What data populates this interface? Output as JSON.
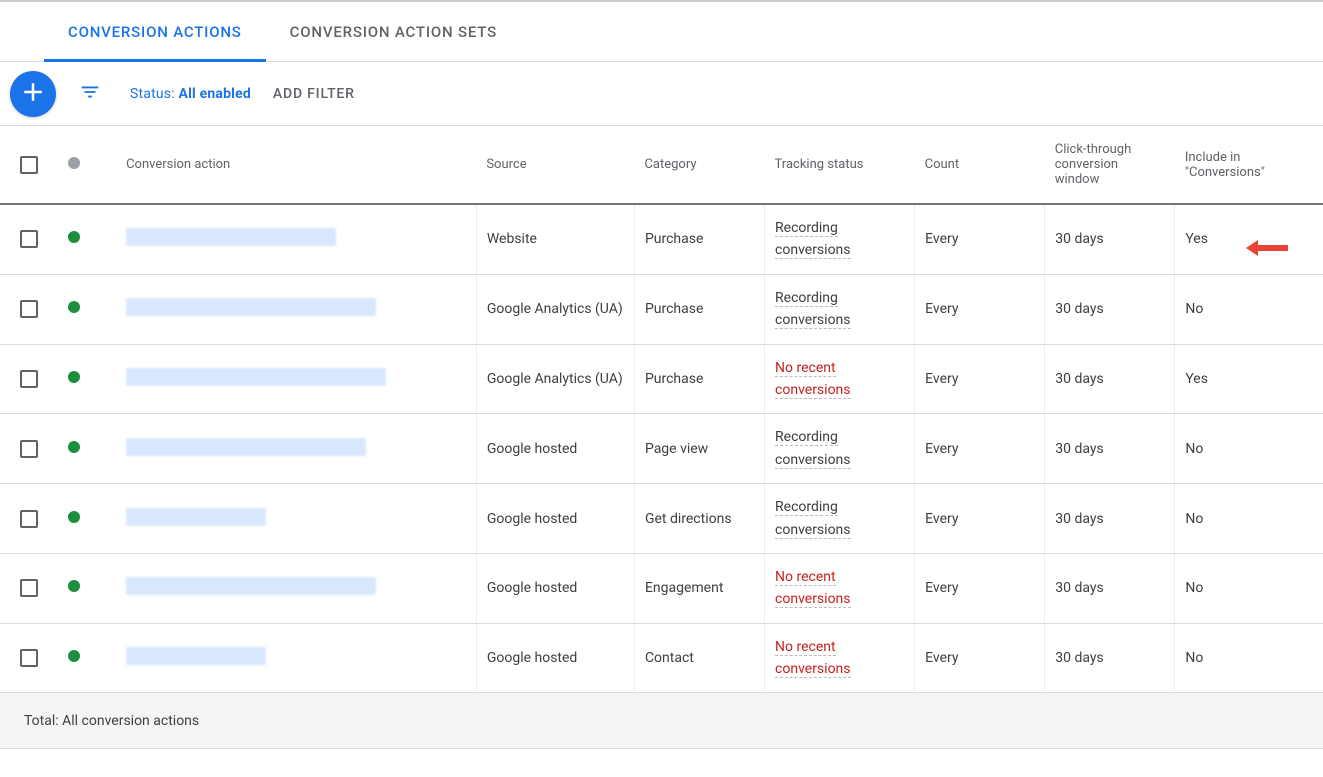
{
  "tabs": {
    "conversion_actions": "CONVERSION ACTIONS",
    "conversion_action_sets": "CONVERSION ACTION SETS"
  },
  "toolbar": {
    "status_label": "Status: ",
    "status_value": "All enabled",
    "add_filter": "ADD FILTER"
  },
  "columns": {
    "conversion_action": "Conversion action",
    "source": "Source",
    "category": "Category",
    "tracking_status": "Tracking status",
    "count": "Count",
    "click_through": "Click-through conversion window",
    "include": "Include in \"Conversions\""
  },
  "rows": [
    {
      "name_w": 210,
      "source": "Website",
      "category": "Purchase",
      "tracking": "Recording conversions",
      "tracking_warn": false,
      "count": "Every",
      "window": "30 days",
      "include": "Yes"
    },
    {
      "name_w": 250,
      "source": "Google Analytics (UA)",
      "category": "Purchase",
      "tracking": "Recording conversions",
      "tracking_warn": false,
      "count": "Every",
      "window": "30 days",
      "include": "No"
    },
    {
      "name_w": 260,
      "source": "Google Analytics (UA)",
      "category": "Purchase",
      "tracking": "No recent conversions",
      "tracking_warn": true,
      "count": "Every",
      "window": "30 days",
      "include": "Yes"
    },
    {
      "name_w": 240,
      "source": "Google hosted",
      "category": "Page view",
      "tracking": "Recording conversions",
      "tracking_warn": false,
      "count": "Every",
      "window": "30 days",
      "include": "No"
    },
    {
      "name_w": 140,
      "source": "Google hosted",
      "category": "Get directions",
      "tracking": "Recording conversions",
      "tracking_warn": false,
      "count": "Every",
      "window": "30 days",
      "include": "No"
    },
    {
      "name_w": 250,
      "source": "Google hosted",
      "category": "Engagement",
      "tracking": "No recent conversions",
      "tracking_warn": true,
      "count": "Every",
      "window": "30 days",
      "include": "No"
    },
    {
      "name_w": 140,
      "source": "Google hosted",
      "category": "Contact",
      "tracking": "No recent conversions",
      "tracking_warn": true,
      "count": "Every",
      "window": "30 days",
      "include": "No"
    }
  ],
  "summary": {
    "label": "Total: All conversion actions"
  }
}
